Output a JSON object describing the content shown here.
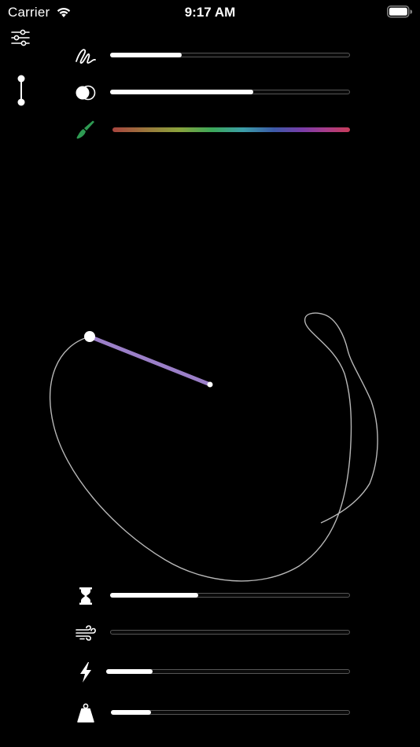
{
  "status_bar": {
    "carrier": "Carrier",
    "time": "9:17 AM",
    "wifi_icon": "wifi-icon",
    "battery_icon": "battery-full-icon"
  },
  "side_buttons": {
    "settings_icon": "sliders-icon",
    "pendulum_toggle_icon": "pendulum-icon"
  },
  "top_sliders": [
    {
      "name": "stroke-width",
      "icon": "scribble-icon",
      "value": 0.3
    },
    {
      "name": "stroke-opacity",
      "icon": "circles-icon",
      "value": 0.6
    },
    {
      "name": "color-hue",
      "icon": "paintbrush-icon",
      "icon_color": "#2e9a52"
    }
  ],
  "bottom_sliders": [
    {
      "name": "time",
      "icon": "hourglass-icon",
      "value": 0.37
    },
    {
      "name": "wind",
      "icon": "wind-icon",
      "value": 0.0
    },
    {
      "name": "energy",
      "icon": "bolt-icon",
      "value": 0.19
    },
    {
      "name": "mass",
      "icon": "weight-icon",
      "value": 0.17
    }
  ],
  "colors": {
    "background": "#000000",
    "pendulum_arm": "#9b7fc8",
    "trace": "#b8b8b8",
    "track_border": "#555555"
  }
}
